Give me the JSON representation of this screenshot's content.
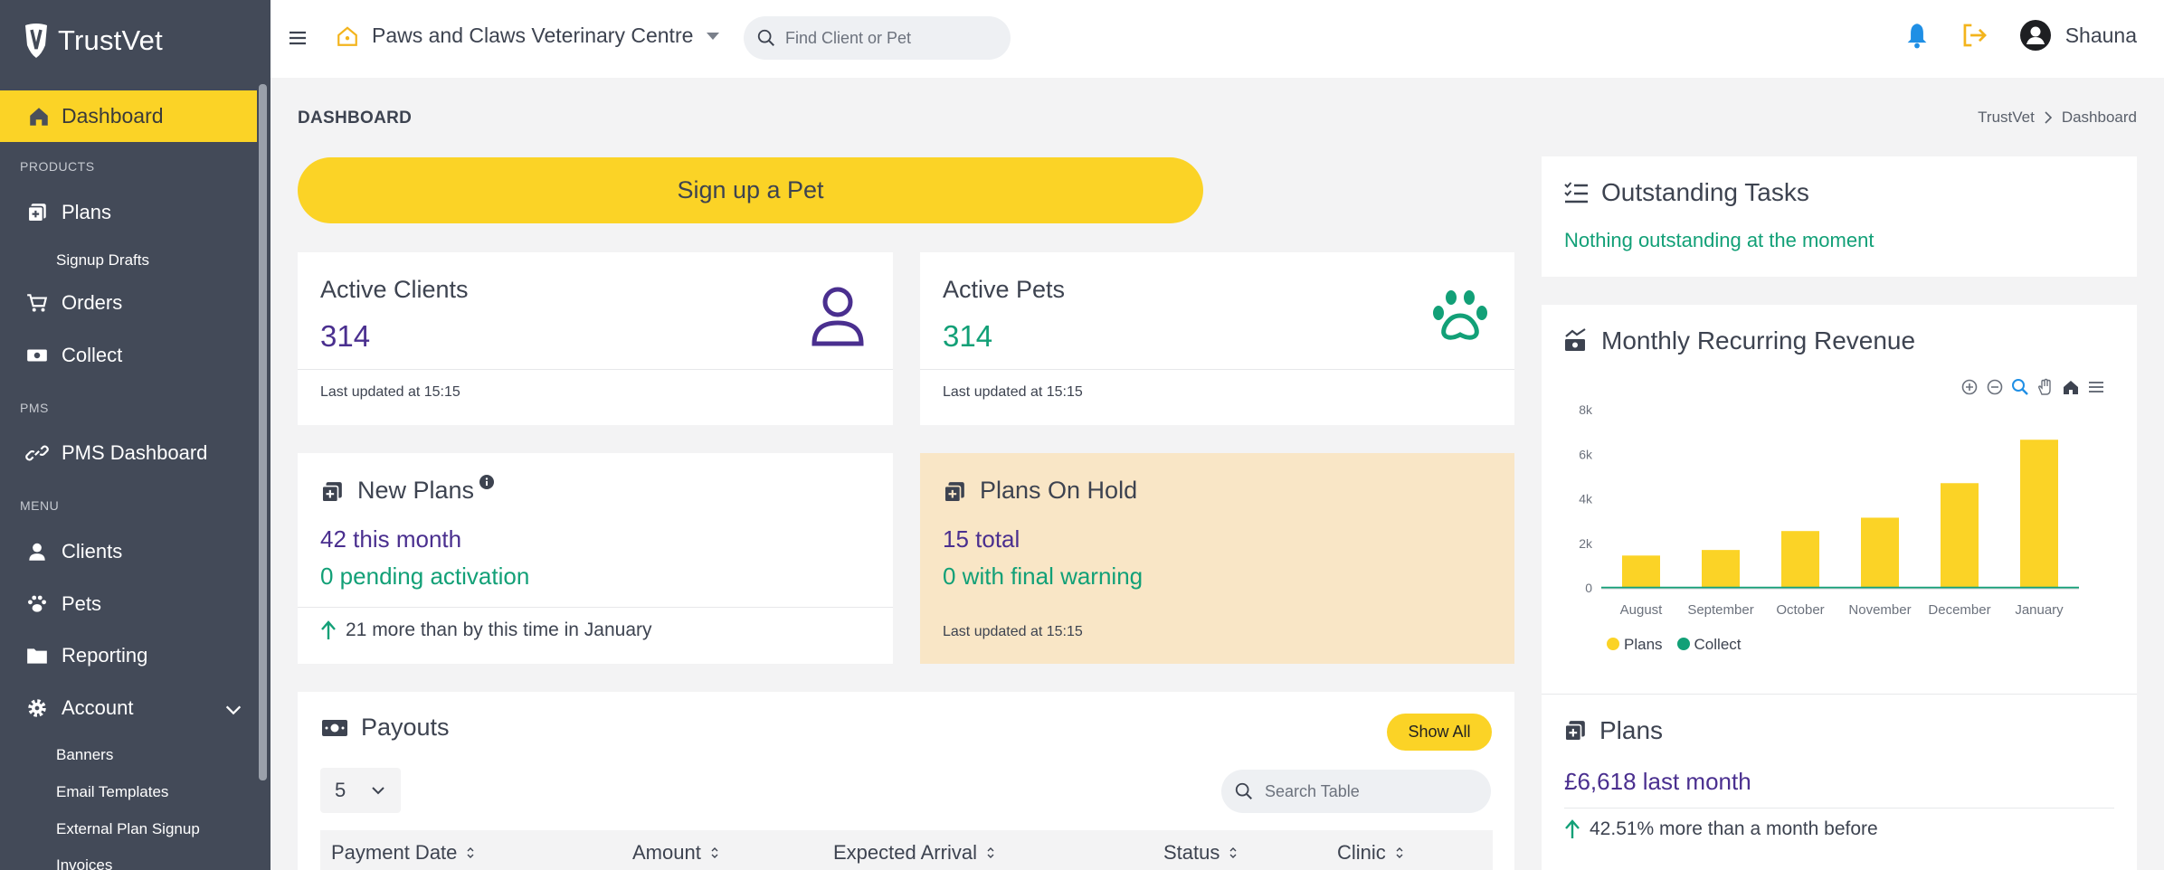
{
  "app": {
    "name": "TrustVet"
  },
  "sidebar": {
    "active": "Dashboard",
    "sections": {
      "products": "PRODUCTS",
      "pms": "PMS",
      "menu": "MENU"
    },
    "items": {
      "plans": "Plans",
      "signup_drafts": "Signup Drafts",
      "orders": "Orders",
      "collect": "Collect",
      "pms_dashboard": "PMS Dashboard",
      "clients": "Clients",
      "pets": "Pets",
      "reporting": "Reporting",
      "account": "Account",
      "banners": "Banners",
      "email_templates": "Email Templates",
      "external_plan_signup": "External Plan Signup",
      "invoices": "Invoices"
    }
  },
  "topbar": {
    "clinic": "Paws and Claws Veterinary Centre",
    "search_placeholder": "Find Client or Pet",
    "user": "Shauna"
  },
  "page": {
    "title": "DASHBOARD",
    "breadcrumb": [
      "TrustVet",
      "Dashboard"
    ],
    "signup_button": "Sign up a Pet"
  },
  "cards": {
    "active_clients": {
      "title": "Active Clients",
      "value": "314",
      "footer": "Last updated at 15:15"
    },
    "active_pets": {
      "title": "Active Pets",
      "value": "314",
      "footer": "Last updated at 15:15"
    },
    "new_plans": {
      "title": "New Plans",
      "line1": "42 this month",
      "line2": "0 pending activation",
      "footer": "21 more than by this time in January"
    },
    "plans_on_hold": {
      "title": "Plans On Hold",
      "line1": "15 total",
      "line2": "0 with final warning",
      "footer": "Last updated at 15:15"
    }
  },
  "payouts": {
    "title": "Payouts",
    "show_all": "Show All",
    "per_page": "5",
    "search_placeholder": "Search Table",
    "columns": [
      "Payment Date",
      "Amount",
      "Expected Arrival",
      "Status",
      "Clinic"
    ]
  },
  "tasks": {
    "title": "Outstanding Tasks",
    "message": "Nothing outstanding at the moment"
  },
  "mrr": {
    "title": "Monthly Recurring Revenue"
  },
  "plans_summary": {
    "title": "Plans",
    "value": "£6,618 last month",
    "change": "42.51% more than a month before"
  },
  "colors": {
    "accent": "#fbd326",
    "sidebar": "#434a58",
    "purple": "#4a2f8f",
    "green": "#12a077",
    "hold_bg": "#f9e6c6"
  },
  "chart_data": {
    "type": "bar",
    "categories": [
      "August",
      "September",
      "October",
      "November",
      "December",
      "January"
    ],
    "series": [
      {
        "name": "Plans",
        "values": [
          1450,
          1700,
          2550,
          3150,
          4700,
          6650
        ]
      },
      {
        "name": "Collect",
        "values": [
          0,
          0,
          0,
          0,
          0,
          0
        ]
      }
    ],
    "y_ticks": [
      "0",
      "2k",
      "4k",
      "6k",
      "8k"
    ],
    "ylim": [
      0,
      8000
    ],
    "legend": "bottom-left",
    "grid": false
  }
}
